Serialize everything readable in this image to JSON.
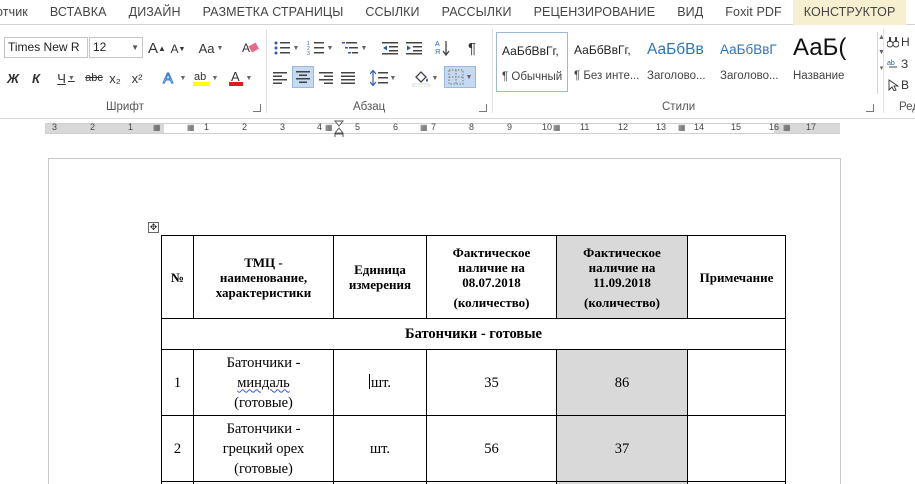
{
  "tabs": [
    "ЗАЙЧИК",
    "ВСТАВКА",
    "ДИЗАЙН",
    "РАЗМЕТКА СТРАНИЦЫ",
    "ССЫЛКИ",
    "РАССЫЛКИ",
    "РЕЦЕНЗИРОВАНИЕ",
    "ВИД",
    "Foxit PDF",
    "КОНСТРУКТОР"
  ],
  "first_tab_visible": "отчик",
  "ribbon": {
    "font": {
      "label": "Шрифт",
      "font_name": "Times New R",
      "font_size": "12",
      "grow": "A",
      "shrink": "A",
      "case": "Aa",
      "bold": "Ж",
      "italic": "К",
      "underline": "Ч",
      "strike": "abc",
      "subscript": "x₂",
      "superscript": "x²",
      "highlight_color": "#ffff00",
      "font_color": "#e01b1b"
    },
    "paragraph": {
      "label": "Абзац",
      "pilcrow": "¶"
    },
    "styles": {
      "label": "Стили",
      "items": [
        {
          "preview": "АаБбВвГг,",
          "name": "¶ Обычный",
          "selected": true
        },
        {
          "preview": "АаБбВвГг,",
          "name": "¶ Без инте...",
          "selected": false
        },
        {
          "preview": "АаБбВв",
          "name": "Заголово...",
          "selected": false
        },
        {
          "preview": "АаБбВвГ",
          "name": "Заголово...",
          "selected": false
        },
        {
          "preview": "АаБ(",
          "name": "Название",
          "selected": false
        }
      ]
    },
    "editing": {
      "label": "Редак",
      "find": "Н",
      "replace": "З",
      "select": "В"
    }
  },
  "ruler": {
    "left_numbers": [
      "3",
      "2",
      "1"
    ],
    "right_numbers": [
      "1",
      "2",
      "3",
      "4",
      "5",
      "6",
      "7",
      "8",
      "9",
      "10",
      "11",
      "12",
      "13",
      "14",
      "15",
      "16",
      "17"
    ]
  },
  "table": {
    "headers": [
      "№",
      "ТМЦ - наименование, характеристики",
      "Единица измерения",
      "Фактическое наличие на 08.07.2018",
      "Фактическое наличие на 11.09.2018",
      "Примечание"
    ],
    "header_qty_suffix": "(количество)",
    "section_title": "Батончики - готовые",
    "rows": [
      {
        "num": "1",
        "name_1": "Батончики -",
        "name_2": "миндаль",
        "name_3": "(готовые)",
        "unit": "шт.",
        "qty_jul": "35",
        "qty_sep": "86",
        "note": ""
      },
      {
        "num": "2",
        "name_1": "Батончики -",
        "name_2": "грецкий орех",
        "name_3": "(готовые)",
        "unit": "шт.",
        "qty_jul": "56",
        "qty_sep": "37",
        "note": ""
      }
    ]
  },
  "colors": {
    "active_tab_bg": "#f7f0d0",
    "highlighted_column": "#d9d9d9",
    "selected_button": "#c5d9f1"
  }
}
